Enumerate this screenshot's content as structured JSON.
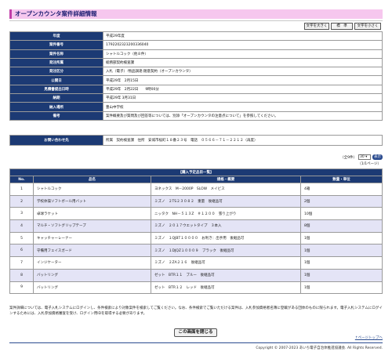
{
  "page_title": "オープンカウンタ案件詳細情報",
  "font_buttons": {
    "large": "文字を大きく",
    "standard": "標　準",
    "small": "文字を小さく"
  },
  "details": [
    {
      "label": "年度",
      "value": "平成29年度"
    },
    {
      "label": "案件番号",
      "value": "1792202323200336040"
    },
    {
      "label": "案件名称",
      "value": "シャトルコック（他８件）"
    },
    {
      "label": "発注所属",
      "value": "総務部契約検査課"
    },
    {
      "label": "発注区分",
      "value": "入札（電子）:物品調達:随意契約（オープンカウンタ）"
    },
    {
      "label": "公開日",
      "value": "平成29年　2月15日"
    },
    {
      "label": "見積書提出日時",
      "value": "平成29年　2月22日　　9時00分"
    },
    {
      "label": "納期",
      "value": "平成29年 3月31日"
    },
    {
      "label": "納入場所",
      "value": "豊山中学校"
    },
    {
      "label": "備考",
      "value": "案件概要及び質問及び回答等については、別添「オープンカウンタの注意点について」を参照してください。"
    }
  ],
  "contact": {
    "label": "お問い合わせ先",
    "value": "所属　契約検査課　住所　安城市桜町１８番２３号　電話　０５６６－７１－２２１２（再度）"
  },
  "pager": {
    "prefix": "（全9件）",
    "per_page": "30 ▾",
    "go": "表示",
    "page_info": "（1/1ページ）"
  },
  "items_table": {
    "caption": "【購入予定品目一覧】",
    "headers": [
      "No.",
      "品名",
      "規格・概要",
      "数量・単位"
    ],
    "rows": [
      [
        "1",
        "シャトルコック",
        "ヨネックス　M－2000P　SLOW　メイビス",
        "4箱"
      ],
      [
        "2",
        "学校体操ソフトボール用バット",
        "ミズノ　２TS２３０８２　重量　後継品可",
        "2個"
      ],
      [
        "3",
        "卓球ラケット",
        "ニッタク　NH－５１３Z　＃１２００　張り上がり",
        "10個"
      ],
      [
        "4",
        "マルチ・ソフトグリップテープ",
        "ミズノ　２０１７ウエットタイプ　３本入",
        "8個"
      ],
      [
        "5",
        "キャッチャーレーナー",
        "ミズノ　１QJBT１００００　お利き：出手用　後継品可",
        "1個"
      ],
      [
        "6",
        "守備用フェイスガード",
        "ミズノ　１DJQZ１０００９　ブラック　後継品可",
        "1個"
      ],
      [
        "7",
        "インジケーター",
        "ミズノ　２ZA２１６　後継品可",
        "1個"
      ],
      [
        "8",
        "バットリング",
        "ゼット　BTR１１　ブルー　後継品可",
        "1個"
      ],
      [
        "9",
        "バットリング",
        "ゼット　BTR１２　レッド　後継品可",
        "1個"
      ]
    ]
  },
  "note": "案件詳細については、電子入札システムにログインし、条件検索により対象案件を検索してご覧ください。なお、条件検索でご覧いただける案件は、入札参加資格者名簿に登載がある団体のものに限られます。電子入札システムにログインするためには、入札参加資格審査を受け、ログイン用IDを取得する必要があります。",
  "close_button": "この画面を閉じる",
  "page_top": "↑ページトップへ",
  "copyright": "Copyright © 2007-2023 あいち電子自治体推進協議会. All Rights Reserved."
}
